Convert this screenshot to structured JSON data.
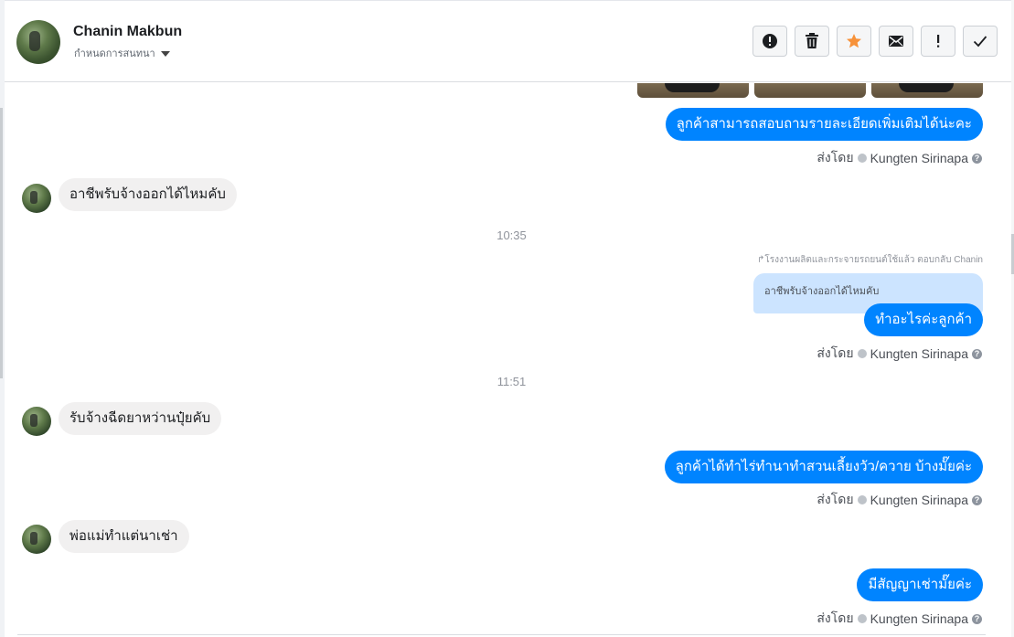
{
  "header": {
    "contact_name": "Chanin Makbun",
    "assign_label": "กำหนดการสนทนา",
    "toolbar": [
      {
        "icon": "alert-circle-icon",
        "name": "mark-spam-button"
      },
      {
        "icon": "trash-icon",
        "name": "delete-button"
      },
      {
        "icon": "star-icon",
        "name": "star-button",
        "color": "#f7923a"
      },
      {
        "icon": "envelope-icon",
        "name": "mark-unread-button"
      },
      {
        "icon": "exclamation-icon",
        "name": "follow-up-button"
      },
      {
        "icon": "check-icon",
        "name": "mark-done-button"
      }
    ]
  },
  "thread": {
    "messages": {
      "out1": "ลูกค้าสามารถสอบถามรายละเอียดเพิ่มเติมได้น่ะคะ",
      "in1": "อาชีพรับจ้างออกได้ไหมคับ",
      "time1": "10:35",
      "reply_note": "โรงงานผลิตและกระจายรถยนต์ใช้แล้ว ตอบกลับ Chanin",
      "quoted": "อาชีพรับจ้างออกได้ไหมคับ",
      "out2": "ทำอะไรค่ะลูกค้า",
      "time2": "11:51",
      "in2": "รับจ้างฉีดยาหว่านปุ๋ยคับ",
      "out3": "ลูกค้าได้ทำไร่ทำนาทำสวนเลี้ยงวัว/ควาย บ้างมั๊ยค่ะ",
      "in3": "พ่อแม่ทำแต่นาเช่า",
      "out4": "มีสัญญาเช่ามั๊ยค่ะ"
    },
    "sent_by": {
      "label": "ส่งโดย",
      "agent": "Kungten Sirinapa"
    }
  },
  "colors": {
    "accent": "#0084ff",
    "incoming_bubble": "#f1f0f0",
    "quoted_bg": "#cce4ff",
    "star": "#f7923a"
  }
}
